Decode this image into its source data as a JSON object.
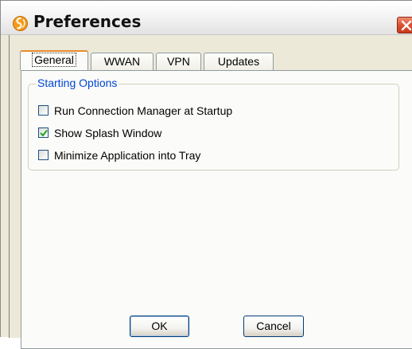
{
  "window": {
    "title": "Preferences",
    "app_icon": "swirl-logo-icon",
    "close_icon": "close-icon"
  },
  "tabs": [
    {
      "label": "General",
      "active": true
    },
    {
      "label": "WWAN",
      "active": false
    },
    {
      "label": "VPN",
      "active": false
    },
    {
      "label": "Updates",
      "active": false
    }
  ],
  "starting_options": {
    "legend": "Starting Options",
    "options": [
      {
        "label": "Run Connection Manager at Startup",
        "checked": false
      },
      {
        "label": "Show Splash Window",
        "checked": true
      },
      {
        "label": "Minimize Application into Tray",
        "checked": false
      }
    ]
  },
  "buttons": {
    "ok": "OK",
    "cancel": "Cancel"
  },
  "colors": {
    "accent": "#0046d5",
    "tab_highlight": "#e68b2c",
    "close": "#de4f2f",
    "checkmark": "#21a121"
  }
}
